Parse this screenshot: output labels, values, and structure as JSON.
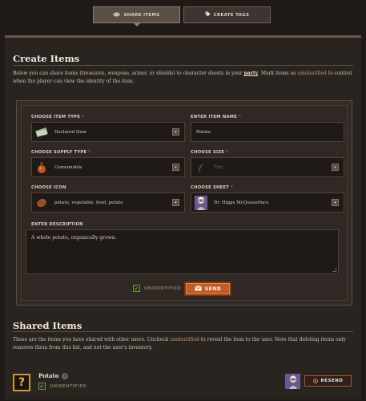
{
  "tabs": [
    {
      "label": "SHARE ITEMS",
      "icon": "eye-icon",
      "active": true
    },
    {
      "label": "CREATE TAGS",
      "icon": "tag-icon",
      "active": false
    }
  ],
  "create": {
    "title": "Create Items",
    "intro_before": "Below you can share items (treasures, weapons, armor, or shields) to character sheets in your ",
    "intro_party": "party",
    "intro_middle": ". Mark items as ",
    "intro_unidentified": "unidentified",
    "intro_after": " to control when the player can view the identity of the item."
  },
  "form": {
    "item_type": {
      "label": "CHOOSE ITEM TYPE",
      "value": "Declared Item",
      "icon": "banknote-icon"
    },
    "item_name": {
      "label": "ENTER ITEM NAME",
      "value": "Potato"
    },
    "supply_type": {
      "label": "CHOOSE SUPPLY TYPE",
      "value": "Consumable",
      "icon": "potion-icon"
    },
    "size": {
      "label": "CHOOSE SIZE",
      "value": "Tiny",
      "icon": "feather-icon"
    },
    "icon": {
      "label": "CHOOSE ICON",
      "value": "potato, vegetable, food, potato",
      "icon": "potato-icon"
    },
    "sheet": {
      "label": "CHOOSE SHEET",
      "value": "Dr. Higgs McQuasarface",
      "icon": "character-avatar"
    },
    "description": {
      "label": "ENTER DESCRIPTION",
      "value": "A whole potato, organically grown."
    },
    "required_mark": "*",
    "unidentified_label": "UNIDENTIFIED",
    "send_label": "SEND"
  },
  "shared": {
    "title": "Shared Items",
    "intro_before": "These are the items you have shared with other users. Uncheck ",
    "intro_unidentified": "unidentified",
    "intro_after": " to reveal the item to the user. Note that deleting items only removes them from this list, and not the user's inventory.",
    "items": [
      {
        "name": "Potato",
        "unidentified_label": "UNIDENTIFIED",
        "resend_label": "RESEND",
        "placeholder_glyph": "?"
      }
    ]
  },
  "colors": {
    "accent": "#c35b26",
    "highlight": "#b79b74",
    "required": "#c9524a",
    "check": "#9ccc5c"
  }
}
